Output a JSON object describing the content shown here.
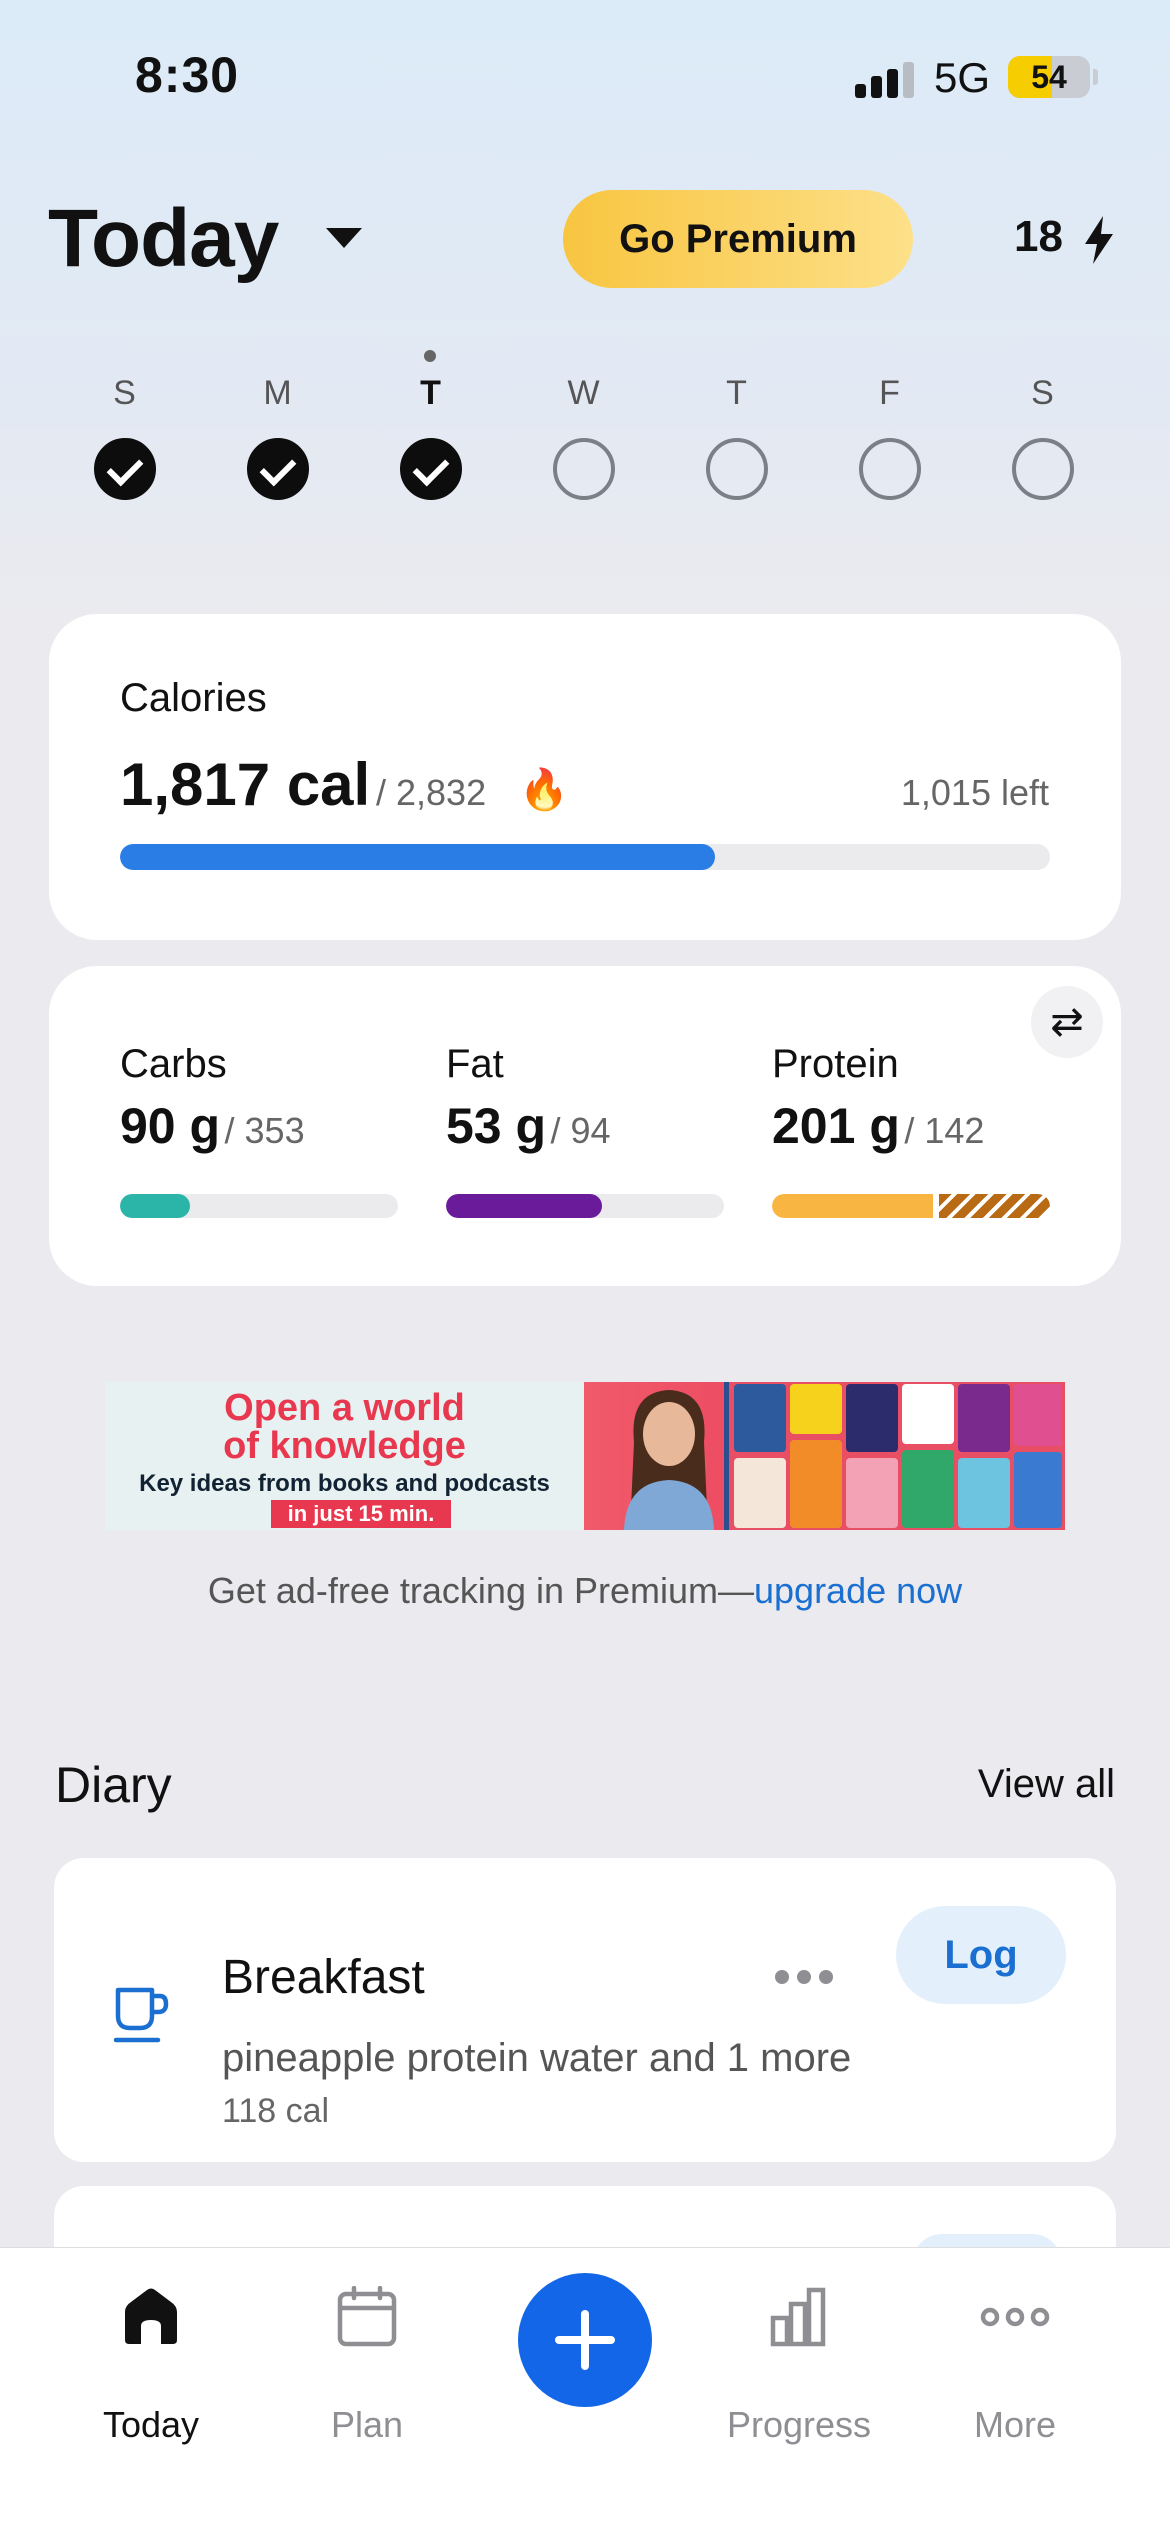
{
  "status_bar": {
    "time": "8:30",
    "network": "5G",
    "battery": "54",
    "battery_level": 0.54
  },
  "header": {
    "title": "Today",
    "premium_label": "Go Premium",
    "streak_count": "18"
  },
  "week": {
    "days": [
      {
        "letter": "S",
        "done": true,
        "today": false
      },
      {
        "letter": "M",
        "done": true,
        "today": false
      },
      {
        "letter": "T",
        "done": true,
        "today": true
      },
      {
        "letter": "W",
        "done": false,
        "today": false
      },
      {
        "letter": "T",
        "done": false,
        "today": false
      },
      {
        "letter": "F",
        "done": false,
        "today": false
      },
      {
        "letter": "S",
        "done": false,
        "today": false
      }
    ]
  },
  "calories": {
    "label": "Calories",
    "value": "1,817 cal",
    "goal": "/ 2,832",
    "left": "1,015 left",
    "progress": 0.64
  },
  "macros": [
    {
      "name": "Carbs",
      "value": "90 g",
      "goal": "/ 353",
      "progress": 0.25,
      "color": "#2bb5a8"
    },
    {
      "name": "Fat",
      "value": "53 g",
      "goal": "/ 94",
      "progress": 0.56,
      "color": "#6a1b9a"
    },
    {
      "name": "Protein",
      "value": "201 g",
      "goal": "/ 142",
      "progress": 1.0,
      "over": 0.42,
      "color": "#f9b541"
    }
  ],
  "ad": {
    "headline_1": "Open a world",
    "headline_2": "of knowledge",
    "subline": "Key ideas from books and podcasts",
    "pill": "in just 15 min.",
    "note": "Get ad-free tracking in Premium—",
    "note_link": "upgrade now"
  },
  "diary": {
    "title": "Diary",
    "view_all": "View all",
    "meals": [
      {
        "name": "Breakfast",
        "icon": "cup-icon",
        "description": "pineapple protein water and 1 more",
        "calories": "118 cal",
        "log_label": "Log"
      }
    ]
  },
  "tabs": [
    {
      "label": "Today",
      "icon": "home-icon",
      "active": true
    },
    {
      "label": "Plan",
      "icon": "calendar-icon",
      "active": false
    },
    {
      "label": "Progress",
      "icon": "bar-chart-icon",
      "active": false
    },
    {
      "label": "More",
      "icon": "more-icon",
      "active": false
    }
  ],
  "colors": {
    "accent": "#1366e8",
    "calorie_bar": "#2a7de5",
    "premium": "#f8c540",
    "link": "#1a6fd1"
  }
}
